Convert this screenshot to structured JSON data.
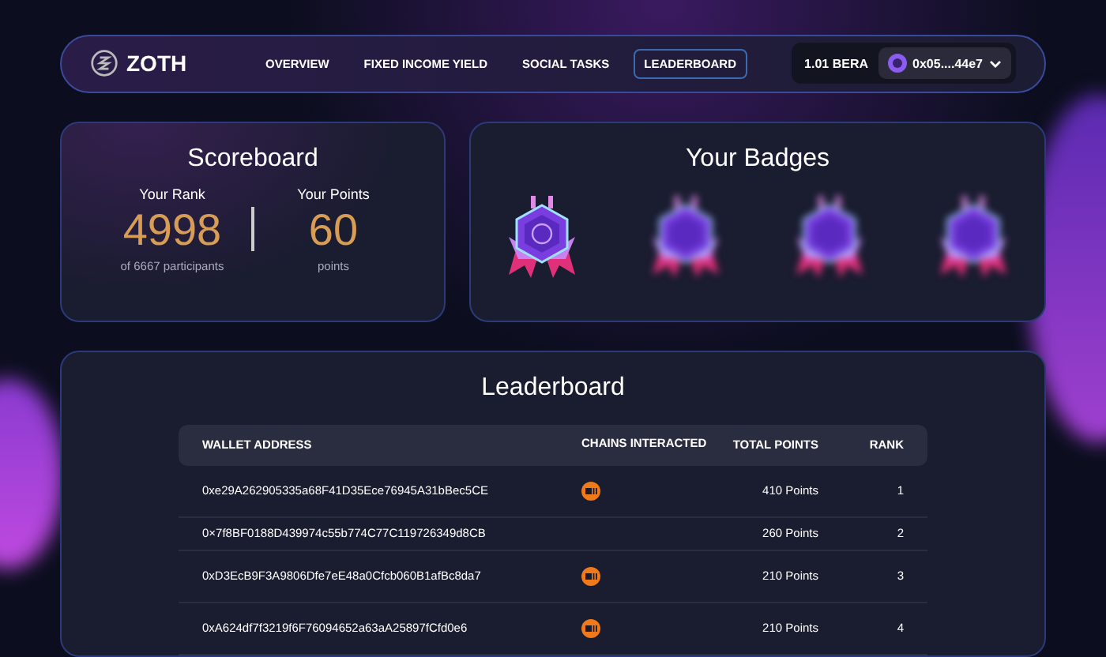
{
  "nav": {
    "logo": "ZOTH",
    "tabs": [
      {
        "label": "OVERVIEW",
        "selected": false
      },
      {
        "label": "FIXED INCOME YIELD",
        "selected": false
      },
      {
        "label": "SOCIAL TASKS",
        "selected": false
      },
      {
        "label": "LEADERBOARD",
        "selected": true
      }
    ],
    "balance": "1.01 BERA",
    "wallet": "0x05....44e7"
  },
  "scoreboard": {
    "title": "Scoreboard",
    "rank_label": "Your Rank",
    "rank": "4998",
    "rank_note": "of 6667 participants",
    "points_label": "Your Points",
    "points": "60",
    "points_note": "points"
  },
  "badges": {
    "title": "Your Badges",
    "items": [
      {
        "earned": true
      },
      {
        "earned": false
      },
      {
        "earned": false
      },
      {
        "earned": false
      }
    ]
  },
  "leaderboard": {
    "title": "Leaderboard",
    "columns": [
      "WALLET ADDRESS",
      "CHAINS INTERACTED",
      "TOTAL POINTS",
      "RANK"
    ],
    "rows": [
      {
        "wallet": "0xe29A262905335a68F41D35Ece76945A31bBec5CE",
        "chain": true,
        "points": "410 Points",
        "rank": "1"
      },
      {
        "wallet": "0×7f8BF0188D439974c55b774C77C119726349d8CB",
        "chain": false,
        "points": "260 Points",
        "rank": "2"
      },
      {
        "wallet": "0xD3EcB9F3A9806Dfe7eE48a0Cfcb060B1afBc8da7",
        "chain": true,
        "points": "210 Points",
        "rank": "3"
      },
      {
        "wallet": "0xA624df7f3219f6F76094652a63aA25897fCfd0e6",
        "chain": true,
        "points": "210 Points",
        "rank": "4"
      }
    ]
  }
}
